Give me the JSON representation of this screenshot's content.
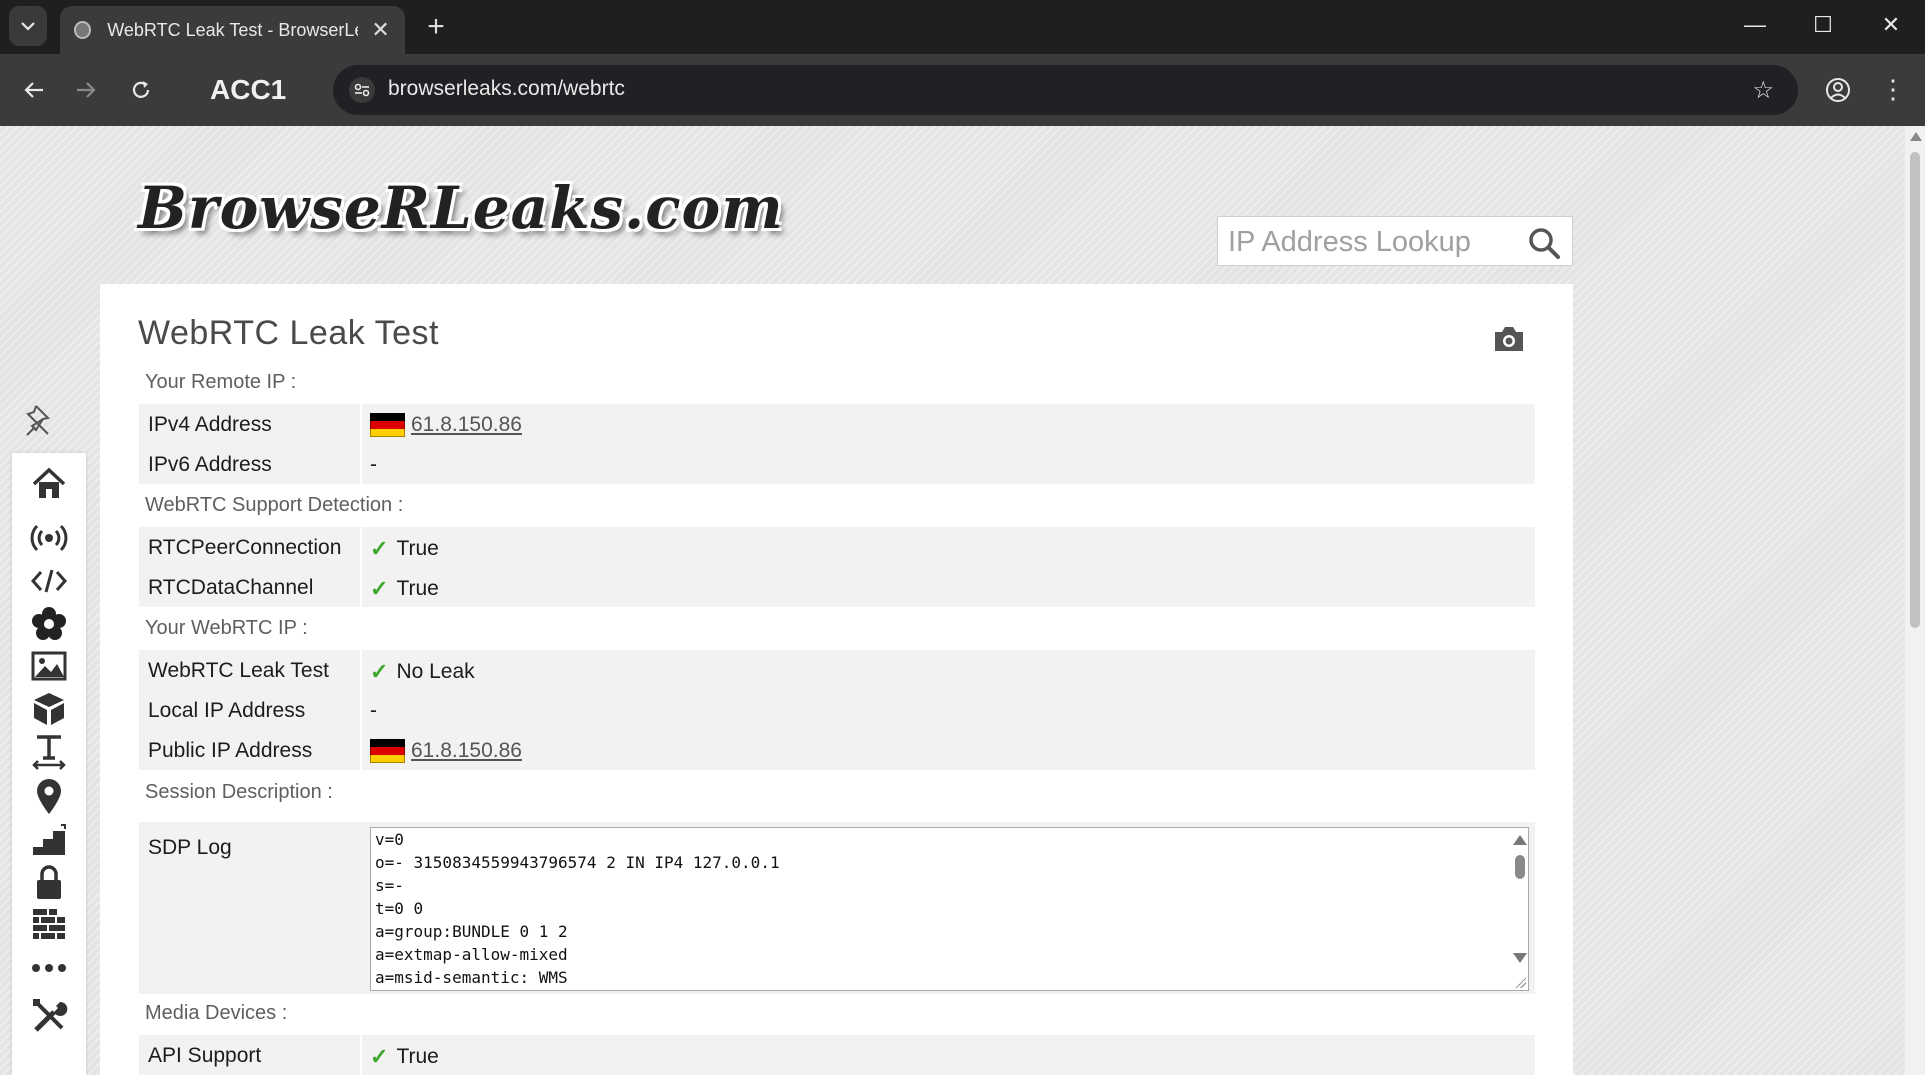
{
  "browser": {
    "tab_title": "WebRTC Leak Test - BrowserLeaks",
    "new_tab_label": "+",
    "tab_close": "✕",
    "profile_label": "ACC1",
    "url": "browserleaks.com/webrtc",
    "window": {
      "minimize": "—",
      "maximize": "☐",
      "close": "✕"
    }
  },
  "site": {
    "logo_text": "BrowseRLeaks.com",
    "search_placeholder": "IP Address Lookup"
  },
  "sidebar": {
    "items": [
      "home-icon",
      "broadcast-icon",
      "code-icon",
      "flower-icon",
      "image-icon",
      "cube-icon",
      "font-icon",
      "location-pin-icon",
      "stairs-icon",
      "lock-icon",
      "firewall-icon",
      "more-icon",
      "tools-icon"
    ]
  },
  "main": {
    "title": "WebRTC Leak Test",
    "sections": {
      "remote_ip": "Your Remote IP :",
      "support": "WebRTC Support Detection :",
      "webrtc_ip": "Your WebRTC IP :",
      "session": "Session Description :",
      "media": "Media Devices :"
    },
    "remote": {
      "ipv4_label": "IPv4 Address",
      "ipv4_value": "61.8.150.86",
      "ipv6_label": "IPv6 Address",
      "ipv6_value": "-"
    },
    "support": {
      "peer_label": "RTCPeerConnection",
      "peer_value": "True",
      "data_label": "RTCDataChannel",
      "data_value": "True"
    },
    "webrtc": {
      "leak_label": "WebRTC Leak Test",
      "leak_value": "No Leak",
      "local_label": "Local IP Address",
      "local_value": "-",
      "public_label": "Public IP Address",
      "public_value": "61.8.150.86"
    },
    "sdp": {
      "label": "SDP Log",
      "lines": [
        "v=0",
        "o=- 3150834559943796574 2 IN IP4 127.0.0.1",
        "s=-",
        "t=0 0",
        "a=group:BUNDLE 0 1 2",
        "a=extmap-allow-mixed",
        "a=msid-semantic: WMS"
      ]
    },
    "media": {
      "api_label": "API Support",
      "api_value": "True"
    }
  }
}
